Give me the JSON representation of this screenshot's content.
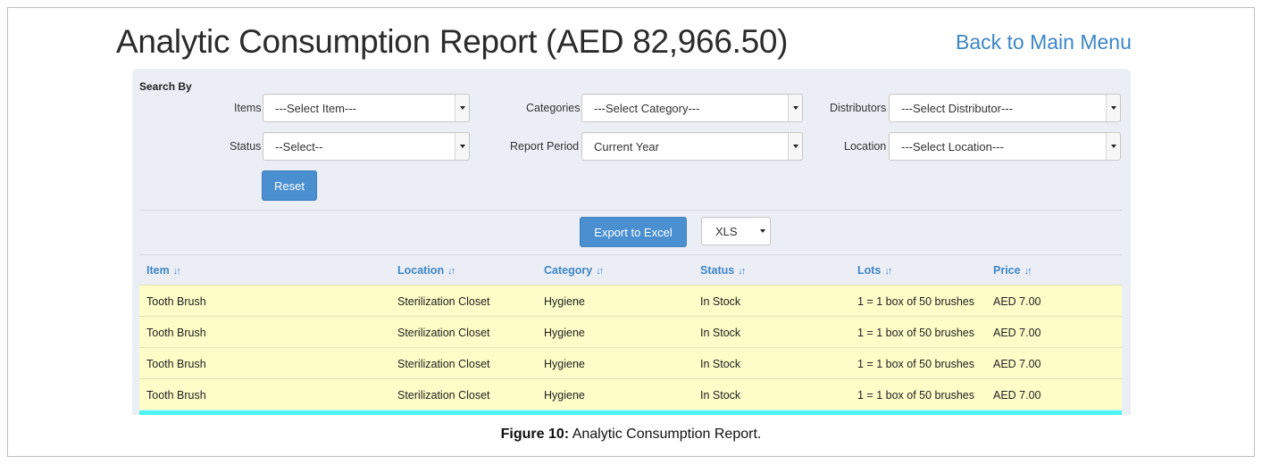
{
  "header": {
    "title": "Analytic Consumption Report (AED 82,966.50)",
    "back_link": "Back to Main Menu"
  },
  "search": {
    "heading": "Search By",
    "filters": [
      {
        "label": "Items",
        "value": "---Select Item---"
      },
      {
        "label": "Categories",
        "value": "---Select Category---"
      },
      {
        "label": "Distributors",
        "value": "---Select Distributor---"
      },
      {
        "label": "Status",
        "value": "--Select--"
      },
      {
        "label": "Report Period",
        "value": "Current Year"
      },
      {
        "label": "Location",
        "value": "---Select Location---"
      }
    ],
    "reset_label": "Reset"
  },
  "export": {
    "button_label": "Export to Excel",
    "format": "XLS"
  },
  "table": {
    "sort_icon": "↓↑",
    "columns": [
      "Item",
      "Location",
      "Category",
      "Status",
      "Lots",
      "Price"
    ],
    "rows": [
      [
        "Tooth Brush",
        "Sterilization Closet",
        "Hygiene",
        "In Stock",
        "1 = 1 box of 50 brushes",
        "AED 7.00"
      ],
      [
        "Tooth Brush",
        "Sterilization Closet",
        "Hygiene",
        "In Stock",
        "1 = 1 box of 50 brushes",
        "AED 7.00"
      ],
      [
        "Tooth Brush",
        "Sterilization Closet",
        "Hygiene",
        "In Stock",
        "1 = 1 box of 50 brushes",
        "AED 7.00"
      ],
      [
        "Tooth Brush",
        "Sterilization Closet",
        "Hygiene",
        "In Stock",
        "1 = 1 box of 50 brushes",
        "AED 7.00"
      ]
    ]
  },
  "caption": {
    "label": "Figure 10:",
    "text": " Analytic Consumption Report."
  },
  "colors": {
    "link_blue": "#3d86c6",
    "button_blue": "#4a8fd0",
    "panel_bg": "#eceef6",
    "row_highlight": "#fdfdc7",
    "bottom_bar": "#4ef3f3"
  }
}
